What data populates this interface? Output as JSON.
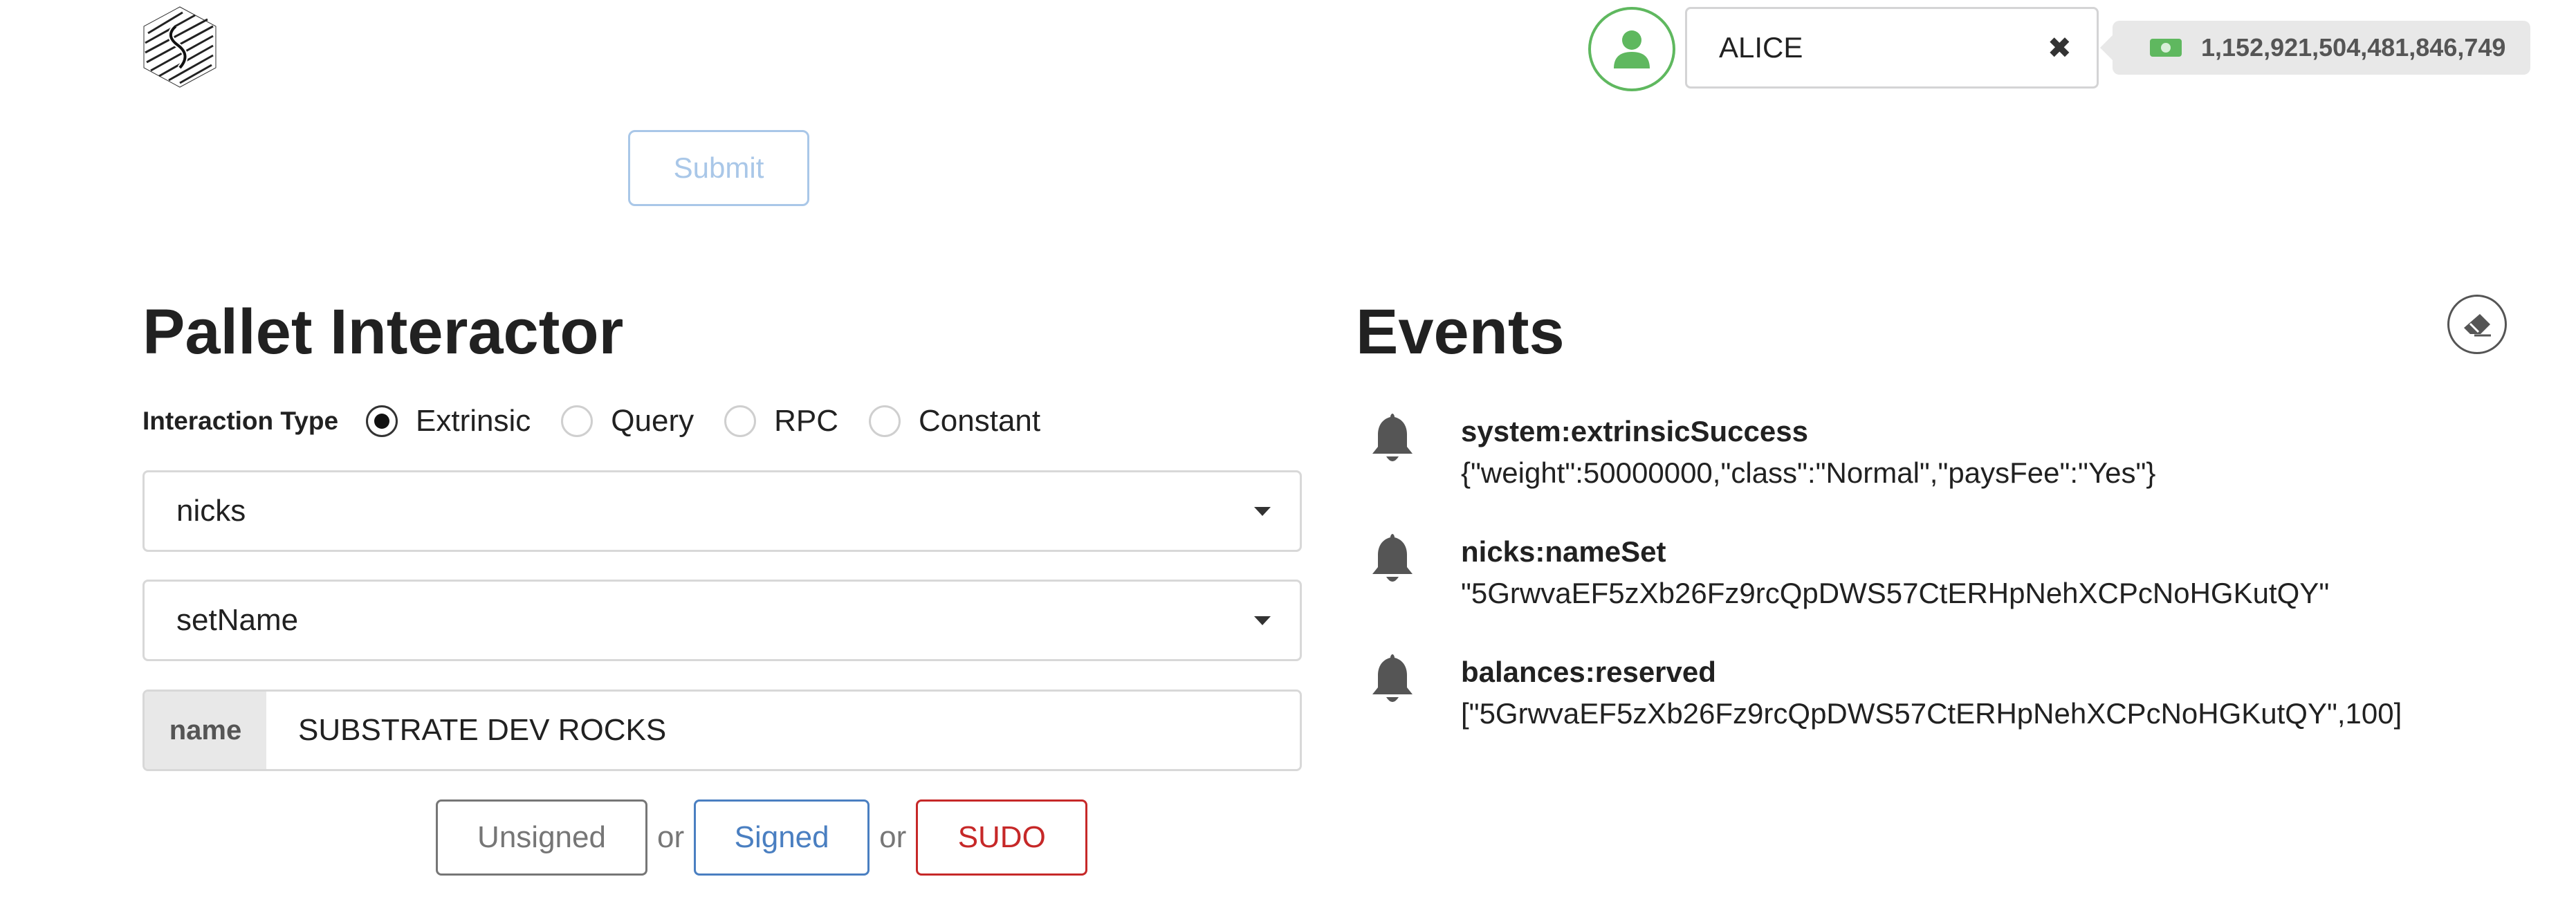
{
  "header": {
    "account": "ALICE",
    "balance": "1,152,921,504,481,846,749"
  },
  "submit_label": "Submit",
  "pallet": {
    "title": "Pallet Interactor",
    "interaction_type_label": "Interaction Type",
    "interaction_types": [
      "Extrinsic",
      "Query",
      "RPC",
      "Constant"
    ],
    "selected_interaction_type": "Extrinsic",
    "pallet_value": "nicks",
    "callable_value": "setName",
    "param_label": "name",
    "param_value": "SUBSTRATE DEV ROCKS",
    "sign_buttons": {
      "unsigned": "Unsigned",
      "or1": "or",
      "signed": "Signed",
      "or2": "or",
      "sudo": "SUDO"
    }
  },
  "events": {
    "title": "Events",
    "items": [
      {
        "name": "system:extrinsicSuccess",
        "detail": "{\"weight\":50000000,\"class\":\"Normal\",\"paysFee\":\"Yes\"}"
      },
      {
        "name": "nicks:nameSet",
        "detail": "\"5GrwvaEF5zXb26Fz9rcQpDWS57CtERHpNehXCPcNoHGKutQY\""
      },
      {
        "name": "balances:reserved",
        "detail": "[\"5GrwvaEF5zXb26Fz9rcQpDWS57CtERHpNehXCPcNoHGKutQY\",100]"
      }
    ]
  },
  "colors": {
    "account_green": "#5fb85f",
    "signed_blue": "#4a7fc1",
    "sudo_red": "#c62828",
    "submit_disabled": "#a9c7e8"
  },
  "icons": {
    "logo": "substrate-logo-icon",
    "account": "user-icon",
    "clear": "close-icon",
    "balance": "money-icon",
    "event": "bell-icon",
    "clear_events": "eraser-icon",
    "dropdown": "caret-down-icon"
  }
}
